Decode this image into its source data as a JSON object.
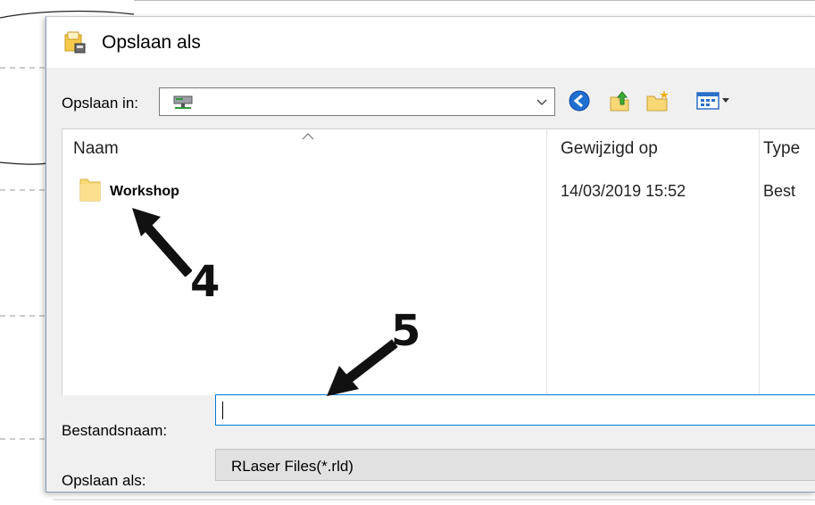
{
  "dialog": {
    "title": "Opslaan als",
    "title_icon": "save-dialog-icon"
  },
  "toolbar": {
    "save_in_label": "Opslaan in:",
    "save_in_value_icon": "network-drive-icon",
    "icons": [
      "back-icon",
      "up-folder-icon",
      "new-folder-icon",
      "views-menu-icon"
    ]
  },
  "file_list": {
    "columns": [
      "Naam",
      "Gewijzigd op",
      "Type"
    ],
    "rows": [
      {
        "name": "Workshop",
        "modified": "14/03/2019 15:52",
        "type": "Best",
        "icon": "folder-icon"
      }
    ]
  },
  "filename": {
    "label": "Bestandsnaam:",
    "value": ""
  },
  "filetype": {
    "label": "Opslaan als:",
    "value": "RLaser Files(*.rld)"
  },
  "annotations": {
    "step_4": "4",
    "step_5": "5"
  },
  "colors": {
    "input_focus_border": "#0078d7",
    "folder_yellow": "#f8d775",
    "back_blue": "#1f6fd1"
  }
}
